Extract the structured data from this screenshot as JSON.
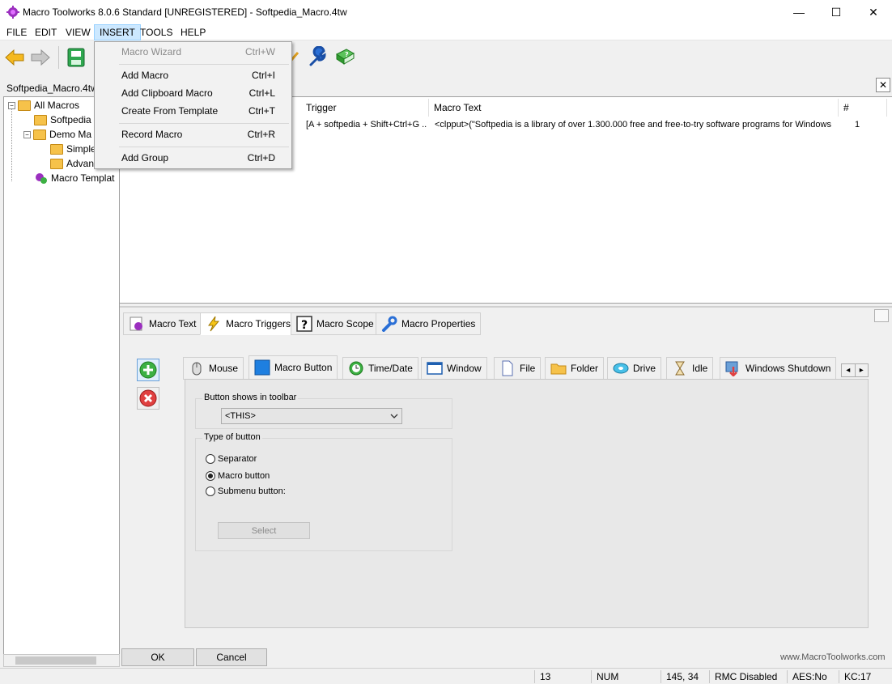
{
  "window": {
    "title": "Macro Toolworks 8.0.6 Standard [UNREGISTERED] - Softpedia_Macro.4tw",
    "controls": [
      "—",
      "☐",
      "✕"
    ]
  },
  "menubar": [
    "FILE",
    "EDIT",
    "VIEW",
    "INSERT",
    "TOOLS",
    "HELP"
  ],
  "insert_menu": [
    {
      "label": "Macro Wizard",
      "shortcut": "Ctrl+W"
    },
    {
      "label": "Add Macro",
      "shortcut": "Ctrl+I"
    },
    {
      "label": "Add Clipboard Macro",
      "shortcut": "Ctrl+L"
    },
    {
      "label": "Create From Template",
      "shortcut": "Ctrl+T"
    },
    {
      "label": "Record Macro",
      "shortcut": "Ctrl+R"
    },
    {
      "label": "Add Group",
      "shortcut": "Ctrl+D"
    }
  ],
  "doc_tab": "Softpedia_Macro.4tw",
  "doc_close": "✕",
  "tree": [
    "All Macros",
    "Softpedia",
    "Demo Ma",
    "Simple",
    "Advan",
    "Macro Templat"
  ],
  "list": {
    "columns": [
      "Trigger",
      "Macro Text",
      "#"
    ],
    "row": {
      "trigger": "[A + softpedia + Shift+Ctrl+G ...",
      "text": "<clpput>(\"Softpedia is a library of over 1.300.000 free and free-to-try software programs for Windows a...",
      "count": "1"
    }
  },
  "main_tabs": [
    "Macro Text",
    "Macro Triggers",
    "Macro Scope",
    "Macro Properties"
  ],
  "trigger_tabs": [
    "Mouse",
    "Macro Button",
    "Time/Date",
    "Window",
    "File",
    "Folder",
    "Drive",
    "Idle",
    "Windows Shutdown"
  ],
  "tab_scroll": [
    "◂",
    "▸"
  ],
  "button_panel": {
    "shows_group": "Button shows in toolbar",
    "shows_value": "<THIS>",
    "type_group": "Type of button",
    "options": [
      "Separator",
      "Macro button",
      "Submenu button:"
    ],
    "selected": "Macro button",
    "select_label": "Select"
  },
  "footer": {
    "ok": "OK",
    "cancel": "Cancel",
    "website": "www.MacroToolworks.com"
  },
  "statusbar": [
    "13",
    "NUM",
    "145, 34",
    "RMC Disabled",
    "AES:No",
    "KC:17"
  ],
  "colors": {
    "accent": "#cce8ff",
    "folder": "#f6c24a",
    "add_green": "#3cb043",
    "remove_red": "#e04040"
  }
}
